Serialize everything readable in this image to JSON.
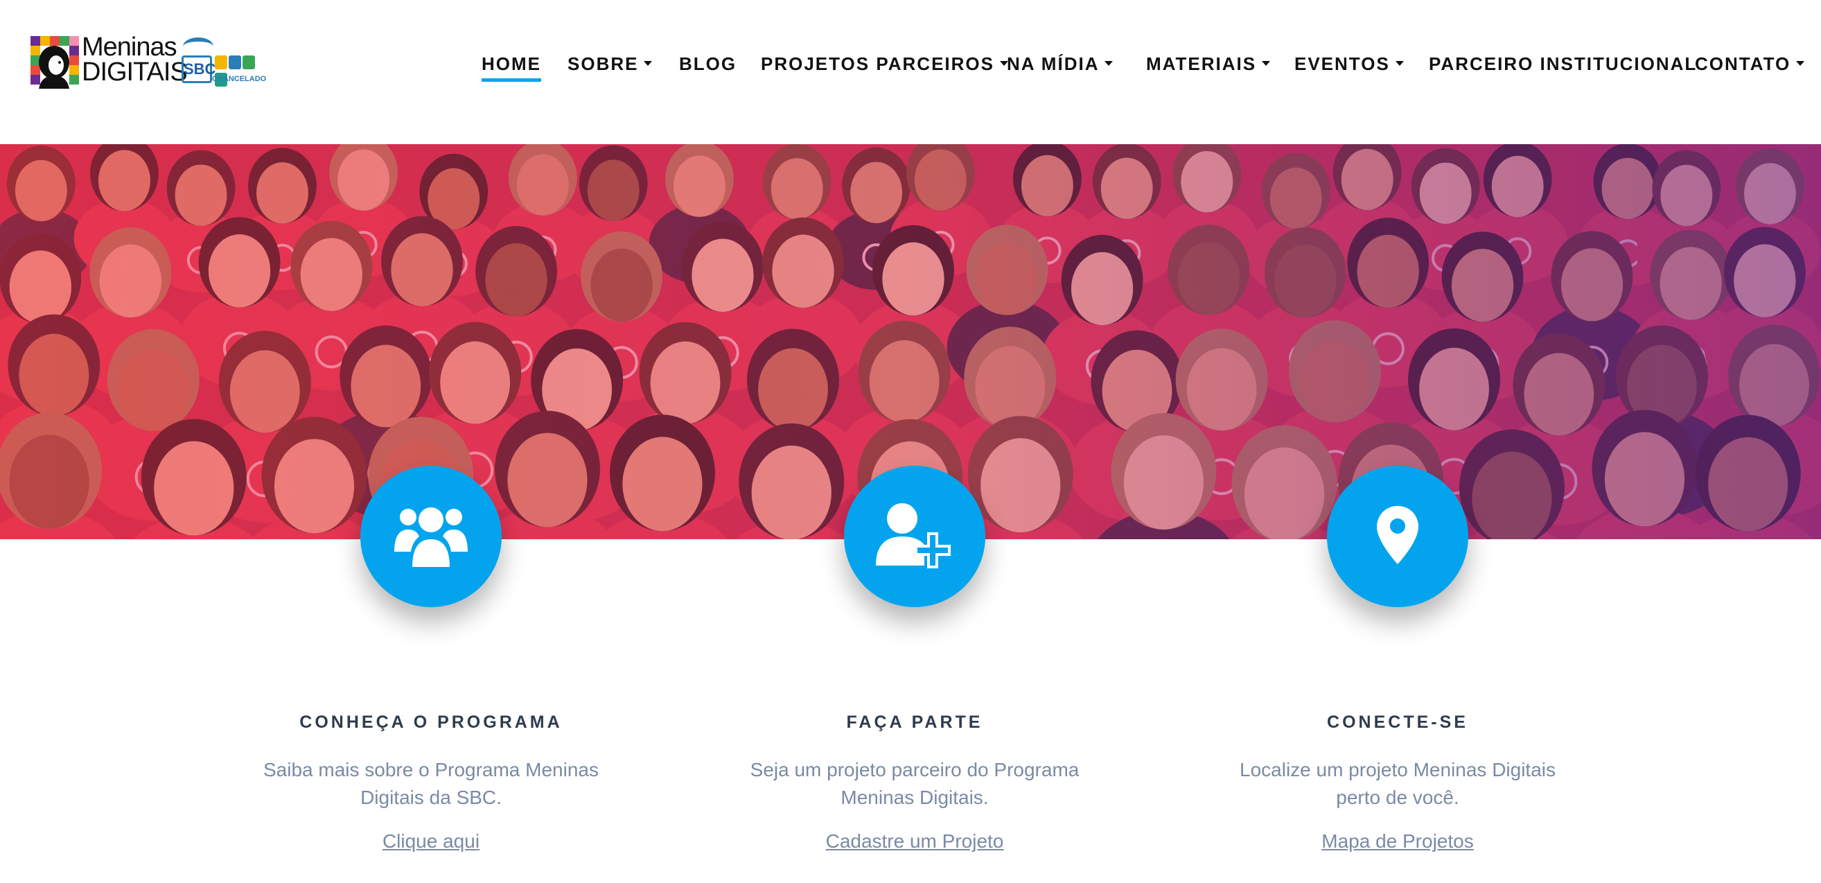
{
  "header": {
    "logo": {
      "line1": "Meninas",
      "line2": "Digitais",
      "sbc_label": "SBC",
      "chancelado_label": "CHANCELADO"
    },
    "nav": [
      {
        "label": "HOME",
        "active": true,
        "has_dropdown": false
      },
      {
        "label": "SOBRE",
        "active": false,
        "has_dropdown": true
      },
      {
        "label": "BLOG",
        "active": false,
        "has_dropdown": false
      },
      {
        "label": "PROJETOS PARCEIROS",
        "active": false,
        "has_dropdown": true
      },
      {
        "label": "NA MÍDIA",
        "active": false,
        "has_dropdown": true
      },
      {
        "label": "MATERIAIS",
        "active": false,
        "has_dropdown": true
      },
      {
        "label": "EVENTOS",
        "active": false,
        "has_dropdown": true
      },
      {
        "label": "PARCEIRO INSTITUCIONAL",
        "active": false,
        "has_dropdown": false
      },
      {
        "label": "CONTATO",
        "active": false,
        "has_dropdown": true
      }
    ]
  },
  "hero": {
    "image": "group-photo-red-shirts",
    "gradient_colors": [
      "#e8324a",
      "#7b2a8c"
    ]
  },
  "features": [
    {
      "icon": "users-group-icon",
      "title": "CONHEÇA O PROGRAMA",
      "description": "Saiba mais sobre o Programa Meninas Digitais da SBC.",
      "link_label": "Clique aqui"
    },
    {
      "icon": "user-plus-icon",
      "title": "FAÇA PARTE",
      "description": "Seja um projeto parceiro do Programa Meninas Digitais.",
      "link_label": "Cadastre um Projeto"
    },
    {
      "icon": "map-marker-icon",
      "title": "CONECTE-SE",
      "description": "Localize um projeto Meninas Digitais perto de você.",
      "link_label": "Mapa de Projetos"
    }
  ],
  "colors": {
    "accent": "#03a4ed",
    "title_text": "#2f3b4d",
    "body_text": "#7a8aa5",
    "nav_text": "#111111"
  }
}
